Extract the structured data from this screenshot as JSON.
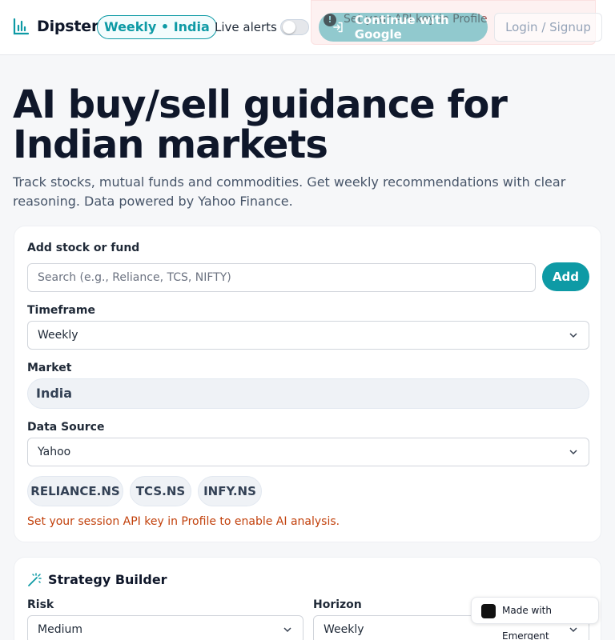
{
  "header": {
    "brand": "Dipster",
    "badge": "Weekly • India",
    "live_alerts_label": "Live alerts",
    "live_alerts_on": false,
    "toast_text": "Set your API key in Profile",
    "google_button": "Continue with Google",
    "login_button": "Login / Signup"
  },
  "hero": {
    "title": "AI buy/sell guidance for Indian markets",
    "subtitle": "Track stocks, mutual funds and commodities. Get weekly recommendations with clear reasoning. Data powered by Yahoo Finance."
  },
  "form": {
    "add_label": "Add stock or fund",
    "search_placeholder": "Search (e.g., Reliance, TCS, NIFTY)",
    "add_button": "Add",
    "timeframe_label": "Timeframe",
    "timeframe_value": "Weekly",
    "market_label": "Market",
    "market_value": "India",
    "source_label": "Data Source",
    "source_value": "Yahoo",
    "chips": [
      "RELIANCE.NS",
      "TCS.NS",
      "INFY.NS"
    ],
    "warning": "Set your session API key in Profile to enable AI analysis."
  },
  "strategy": {
    "title": "Strategy Builder",
    "risk_label": "Risk",
    "risk_value": "Medium",
    "horizon_label": "Horizon",
    "horizon_value": "Weekly"
  },
  "footer_badge": "Made with Emergent",
  "colors": {
    "accent": "#0e9aa5",
    "warning": "#c2410c"
  }
}
